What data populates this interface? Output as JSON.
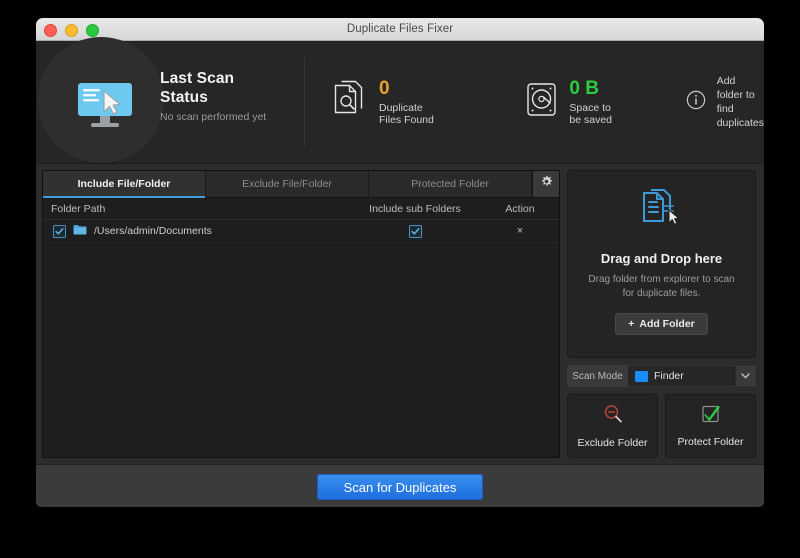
{
  "window": {
    "title": "Duplicate Files Fixer"
  },
  "header": {
    "scan_status": {
      "icon": "monitor-cursor-icon",
      "title_line1": "Last Scan",
      "title_line2": "Status",
      "subtitle": "No scan performed yet"
    },
    "stats": [
      {
        "icon": "documents-search-icon",
        "value": "0",
        "label": "Duplicate Files Found",
        "color": "#e8a030"
      },
      {
        "icon": "harddrive-search-icon",
        "value": "0 B",
        "label": "Space to be saved",
        "color": "#2ecc40"
      }
    ],
    "info": {
      "icon": "info-circle-icon",
      "line1": "Add folder to",
      "line2": "find duplicates"
    }
  },
  "tabs": [
    {
      "label": "Include File/Folder",
      "active": true
    },
    {
      "label": "Exclude File/Folder",
      "active": false
    },
    {
      "label": "Protected Folder",
      "active": false
    }
  ],
  "settings_button": {
    "icon": "gear-icon"
  },
  "table": {
    "columns": [
      "Folder Path",
      "Include sub Folders",
      "Action"
    ],
    "rows": [
      {
        "checked": true,
        "folder_icon": "folder-icon",
        "path": "/Users/admin/Documents",
        "include_sub": true,
        "action": "×"
      }
    ]
  },
  "drop_zone": {
    "icon": "documents-cursor-icon",
    "title": "Drag and Drop here",
    "subtitle": "Drag folder from explorer to scan for duplicate files.",
    "add_folder_label": "Add Folder",
    "add_folder_plus": "+"
  },
  "scan_mode": {
    "label": "Scan Mode",
    "selected": "Finder",
    "icon": "finder-folder-icon",
    "chevron": "chevron-down-icon"
  },
  "action_buttons": [
    {
      "label": "Exclude Folder",
      "icon": "magnifier-minus-icon",
      "color": "#c0392b"
    },
    {
      "label": "Protect Folder",
      "icon": "green-check-icon",
      "color": "#2ecc40"
    }
  ],
  "footer": {
    "scan_label": "Scan for Duplicates"
  }
}
